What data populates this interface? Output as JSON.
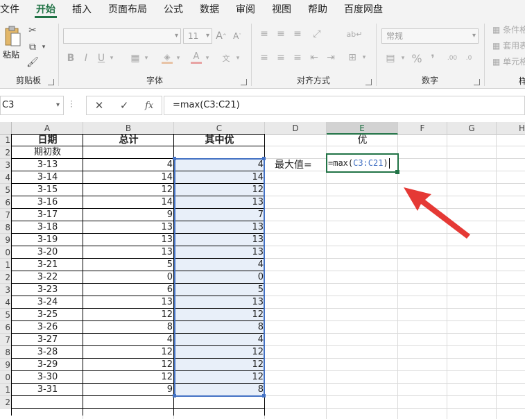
{
  "menu": {
    "tabs": [
      "文件",
      "开始",
      "插入",
      "页面布局",
      "公式",
      "数据",
      "审阅",
      "视图",
      "帮助",
      "百度网盘"
    ],
    "active_index": 1
  },
  "ribbon": {
    "clipboard": {
      "paste_label": "粘贴",
      "group_label": "剪贴板"
    },
    "font": {
      "name_placeholder": "",
      "size_value": "11",
      "group_label": "字体",
      "bold": "B",
      "italic": "I",
      "underline": "U"
    },
    "alignment": {
      "group_label": "对齐方式"
    },
    "number": {
      "format_value": "常规",
      "group_label": "数字"
    },
    "styles": {
      "items": [
        "条件格",
        "套用表",
        "单元格"
      ],
      "group_label": "样"
    }
  },
  "formula_bar": {
    "name_box": "C3",
    "cancel_icon": "✕",
    "enter_icon": "✓",
    "fx_label": "fx",
    "formula": "=max(C3:C21)"
  },
  "sheet": {
    "columns": [
      "A",
      "B",
      "C",
      "D",
      "E",
      "F",
      "G",
      "H"
    ],
    "rows": [
      "1",
      "2",
      "3",
      "4",
      "5",
      "6",
      "7",
      "8",
      "9",
      "0",
      "1",
      "2",
      "3",
      "4",
      "5",
      "6",
      "7",
      "8",
      "9",
      "0",
      "1",
      "2"
    ],
    "headers": {
      "a": "日期",
      "b": "总计",
      "c": "其中优",
      "e": "优"
    },
    "a2": "期初数",
    "table": [
      {
        "date": "3-13",
        "total": "4",
        "good": "4"
      },
      {
        "date": "3-14",
        "total": "14",
        "good": "14"
      },
      {
        "date": "3-15",
        "total": "12",
        "good": "12"
      },
      {
        "date": "3-16",
        "total": "14",
        "good": "13"
      },
      {
        "date": "3-17",
        "total": "9",
        "good": "7"
      },
      {
        "date": "3-18",
        "total": "13",
        "good": "13"
      },
      {
        "date": "3-19",
        "total": "13",
        "good": "13"
      },
      {
        "date": "3-20",
        "total": "13",
        "good": "13"
      },
      {
        "date": "3-21",
        "total": "5",
        "good": "4"
      },
      {
        "date": "3-22",
        "total": "0",
        "good": "0"
      },
      {
        "date": "3-23",
        "total": "6",
        "good": "5"
      },
      {
        "date": "3-24",
        "total": "13",
        "good": "13"
      },
      {
        "date": "3-25",
        "total": "12",
        "good": "12"
      },
      {
        "date": "3-26",
        "total": "8",
        "good": "8"
      },
      {
        "date": "3-27",
        "total": "4",
        "good": "4"
      },
      {
        "date": "3-28",
        "total": "12",
        "good": "12"
      },
      {
        "date": "3-29",
        "total": "12",
        "good": "12"
      },
      {
        "date": "3-30",
        "total": "12",
        "good": "12"
      },
      {
        "date": "3-31",
        "total": "9",
        "good": "8"
      }
    ],
    "d3_label": "最大值=",
    "e3_formula_prefix": "=max(",
    "e3_formula_ref": "C3:C21",
    "e3_formula_suffix": ")",
    "colors": {
      "accent": "#217346",
      "range_ref": "#4472c4",
      "arrow": "#e53935",
      "range_fill": "#e8eff9"
    }
  }
}
